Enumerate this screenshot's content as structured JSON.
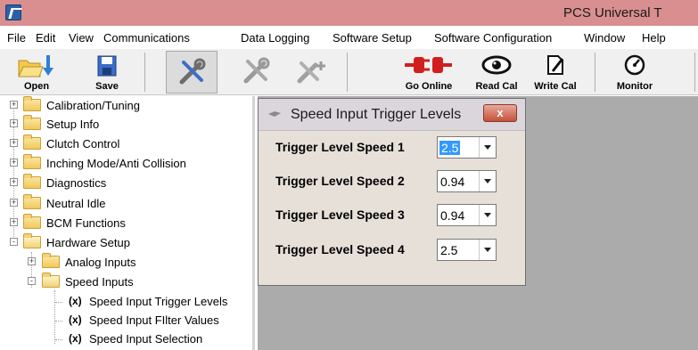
{
  "window": {
    "title": "PCS Universal T"
  },
  "menu": [
    "File",
    "Edit",
    "View",
    "Communications",
    "Data Logging",
    "Software Setup",
    "Software Configuration",
    "Window",
    "Help"
  ],
  "toolbar": {
    "open_label": "Open",
    "save_label": "Save",
    "go_online_label": "Go Online",
    "read_cal_label": "Read Cal",
    "write_cal_label": "Write Cal",
    "monitor_label": "Monitor"
  },
  "tree": {
    "items": [
      {
        "label": "Calibration/Tuning",
        "expander": "+"
      },
      {
        "label": "Setup Info",
        "expander": "+"
      },
      {
        "label": "Clutch Control",
        "expander": "+"
      },
      {
        "label": "Inching Mode/Anti Collision",
        "expander": "+"
      },
      {
        "label": "Diagnostics",
        "expander": "+"
      },
      {
        "label": "Neutral Idle",
        "expander": "+"
      },
      {
        "label": "BCM Functions",
        "expander": "+"
      },
      {
        "label": "Hardware Setup",
        "expander": "-"
      },
      {
        "label": "Analog Inputs",
        "expander": "+"
      },
      {
        "label": "Speed Inputs",
        "expander": "-"
      },
      {
        "label": "Speed Input Trigger Levels",
        "icon": "(x)"
      },
      {
        "label": "Speed Input FIlter Values",
        "icon": "(x)"
      },
      {
        "label": "Speed Input Selection",
        "icon": "(x)"
      }
    ]
  },
  "dialog": {
    "title": "Speed Input Trigger Levels",
    "close_label": "x",
    "fields": [
      {
        "label": "Trigger Level Speed 1",
        "value": "2.5"
      },
      {
        "label": "Trigger Level Speed 2",
        "value": "0.94"
      },
      {
        "label": "Trigger Level Speed 3",
        "value": "0.94"
      },
      {
        "label": "Trigger Level Speed 4",
        "value": "2.5"
      }
    ]
  }
}
